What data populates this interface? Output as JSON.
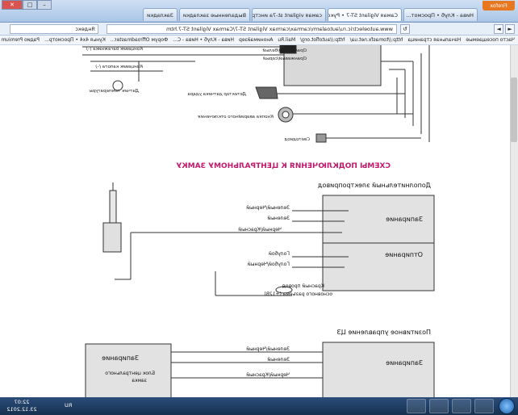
{
  "browser": {
    "app_button": "Firefox",
    "tabs": [
      "Нива - Клуб • Просмот...",
      "Caмая Vigilant ST-7 • Руководство...",
      "caмая vigilant st-7a инструкция...",
      "Выдаленные закладки",
      "Закладки"
    ],
    "url": "www.autoelectric.ru/autoalarm/carmax/carmax Vigilant ST-7/Carmax Vigilant ST-7.htm",
    "search_placeholder": "Яндекс",
    "win_minimize": "–",
    "win_maximize": "□",
    "win_close": "✕",
    "back": "◄",
    "forward": "►",
    "reload": "↻"
  },
  "bookmarks": [
    "Часто посещаемые",
    "Начальная страница",
    "http://tomasfx.net.ua/",
    "http://autoflot.org/",
    "Mail.Ru",
    "Анонимайзер",
    "Нива - Клуб • Нива - С...",
    "Форум Offroadmaster...",
    "Кунья 4x4 • Просмотр...",
    "Радио Premium"
  ],
  "diagram": {
    "top_labels": [
      "Оранжевый/белый",
      "Оранжевый/серый",
      "Концевик багажника (–)",
      "Концевик капота (–)",
      "Датчик температуры",
      "Детектор датчика удара",
      "Кнопка аварийного отключения",
      "Светодиод"
    ],
    "section_title": "СХЕМЫ ПОДКЛЮЧЕНИЯ К ЦЕНТРАЛЬНОМУ ЗАМКУ",
    "actuator_title": "Дополнительный электропривод",
    "lock_label": "Запирание",
    "unlock_label": "Отпирание",
    "wires_top": [
      "Зеленый/Черный",
      "Зеленый",
      "Черный/Красный",
      "Голубой",
      "Голубой/Черный"
    ],
    "red_wire": "Красный провод",
    "red_wire_2": "основного разъема (+12В)",
    "positive_title": "Позитивное управление ЦЗ",
    "wires_bottom": [
      "Зеленый/Черный",
      "Зеленый",
      "Черный/Красный"
    ],
    "lock_label_2": "Запирание",
    "lock_label_3": "Запирание",
    "central_block": "Блок центрального",
    "central_block_2": "замка"
  },
  "taskbar": {
    "lang": "RU",
    "time": "22:07",
    "date": "23.12.2012"
  }
}
